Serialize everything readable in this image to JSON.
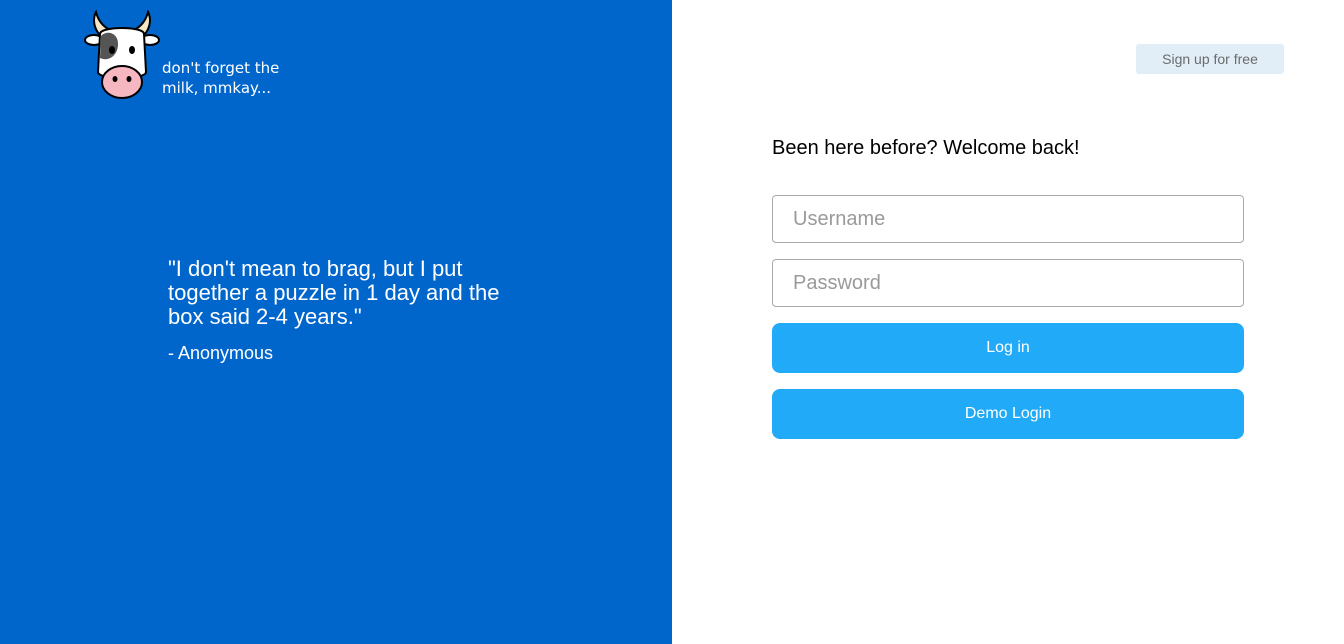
{
  "brand": {
    "tagline": "don't forget the milk, mmkay...",
    "logo_icon": "cow-mascot-icon"
  },
  "colors": {
    "left_panel_bg": "#0066cc",
    "primary_button": "#20aaf7",
    "signup_button_bg": "#e1eef7"
  },
  "testimonial": {
    "quote": "\"I don't mean to brag, but I put together a puzzle in 1 day and the box said 2-4 years.\"",
    "author": "- Anonymous"
  },
  "header": {
    "signup_label": "Sign up for free"
  },
  "login": {
    "heading": "Been here before? Welcome back!",
    "username_placeholder": "Username",
    "password_placeholder": "Password",
    "login_label": "Log in",
    "demo_label": "Demo Login"
  }
}
